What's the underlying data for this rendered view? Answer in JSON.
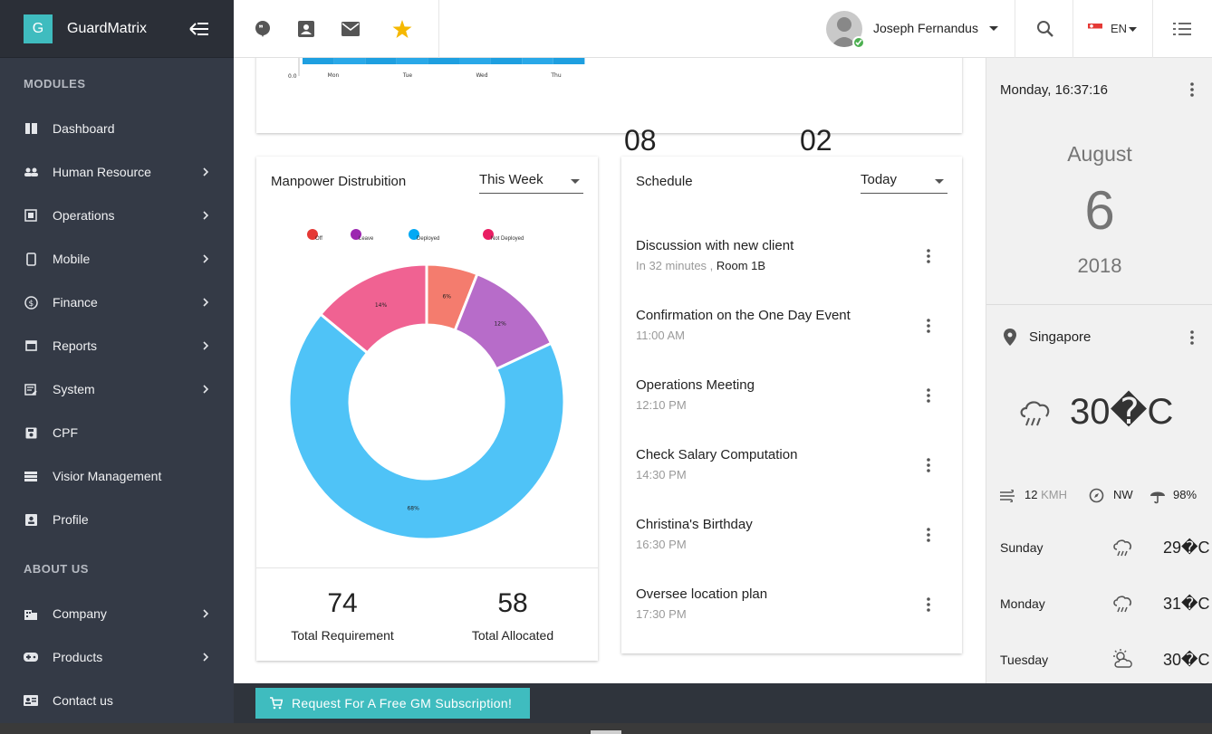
{
  "brand": {
    "logo_letter": "G",
    "name": "GuardMatrix"
  },
  "sidebar": {
    "modules_title": "MODULES",
    "about_title": "ABOUT US",
    "modules": [
      {
        "label": "Dashboard",
        "icon": "dashboard-icon",
        "has_children": false
      },
      {
        "label": "Human Resource",
        "icon": "people-icon",
        "has_children": true
      },
      {
        "label": "Operations",
        "icon": "operations-icon",
        "has_children": true
      },
      {
        "label": "Mobile",
        "icon": "mobile-icon",
        "has_children": true
      },
      {
        "label": "Finance",
        "icon": "dollar-icon",
        "has_children": true
      },
      {
        "label": "Reports",
        "icon": "reports-icon",
        "has_children": true
      },
      {
        "label": "System",
        "icon": "system-icon",
        "has_children": true
      },
      {
        "label": "CPF",
        "icon": "save-icon",
        "has_children": false
      },
      {
        "label": "Visior Management",
        "icon": "list-icon",
        "has_children": false
      },
      {
        "label": "Profile",
        "icon": "profile-icon",
        "has_children": false
      }
    ],
    "about": [
      {
        "label": "Company",
        "icon": "company-icon",
        "has_children": true
      },
      {
        "label": "Products",
        "icon": "gamepad-icon",
        "has_children": true
      },
      {
        "label": "Contact us",
        "icon": "contact-icon",
        "has_children": false
      }
    ]
  },
  "topbar": {
    "icons": [
      "chat-icon",
      "contact-card-icon",
      "mail-icon",
      "star-icon"
    ],
    "user_name": "Joseph Fernandus",
    "language": "EN",
    "accent": "#3fbcbf"
  },
  "top_card": {
    "mini_chart": {
      "categories": [
        "Mon",
        "Tue",
        "Wed",
        "Thu"
      ],
      "y_tick": "0.0"
    },
    "stats": [
      "08",
      "02"
    ]
  },
  "manpower": {
    "title": "Manpower Distrubition",
    "period": "This Week",
    "chart_data": {
      "type": "pie",
      "categories": [
        "Off",
        "Leave",
        "Deployed",
        "Not Deployed"
      ],
      "values": [
        6,
        12,
        68,
        14
      ],
      "colors": [
        "#f47c6e",
        "#b76cc9",
        "#4fc3f7",
        "#f06292"
      ],
      "legend_colors": [
        "#e53935",
        "#9c27b0",
        "#03a9f4",
        "#e91e63"
      ],
      "labels": [
        "6%",
        "12%",
        "68%",
        "14%"
      ],
      "legend_position": "top"
    },
    "total_requirement": {
      "value": "74",
      "label": "Total Requirement"
    },
    "total_allocated": {
      "value": "58",
      "label": "Total Allocated"
    }
  },
  "schedule": {
    "title": "Schedule",
    "period": "Today",
    "items": [
      {
        "title": "Discussion with new client",
        "time": "In 32 minutes",
        "location": "Room 1B"
      },
      {
        "title": "Confirmation on the One Day Event",
        "time": "11:00 AM",
        "location": ""
      },
      {
        "title": "Operations Meeting",
        "time": "12:10 PM",
        "location": ""
      },
      {
        "title": "Check Salary Computation",
        "time": "14:30 PM",
        "location": ""
      },
      {
        "title": "Christina's Birthday",
        "time": "16:30 PM",
        "location": ""
      },
      {
        "title": "Oversee location plan",
        "time": "17:30 PM",
        "location": ""
      }
    ]
  },
  "right_panel": {
    "datetime": "Monday, 16:37:16",
    "month": "August",
    "day": "6",
    "year": "2018",
    "city": "Singapore",
    "temperature": "30�C",
    "wind_speed": "12",
    "wind_unit": "KMH",
    "wind_dir": "NW",
    "humidity": "98%",
    "forecast": [
      {
        "day": "Sunday",
        "temp": "29�C",
        "icon": "rain-cloud-icon"
      },
      {
        "day": "Monday",
        "temp": "31�C",
        "icon": "rain-cloud-icon"
      },
      {
        "day": "Tuesday",
        "temp": "30�C",
        "icon": "sun-cloud-icon"
      }
    ]
  },
  "bottom": {
    "subscribe_label": "Request For A Free GM Subscription!"
  }
}
